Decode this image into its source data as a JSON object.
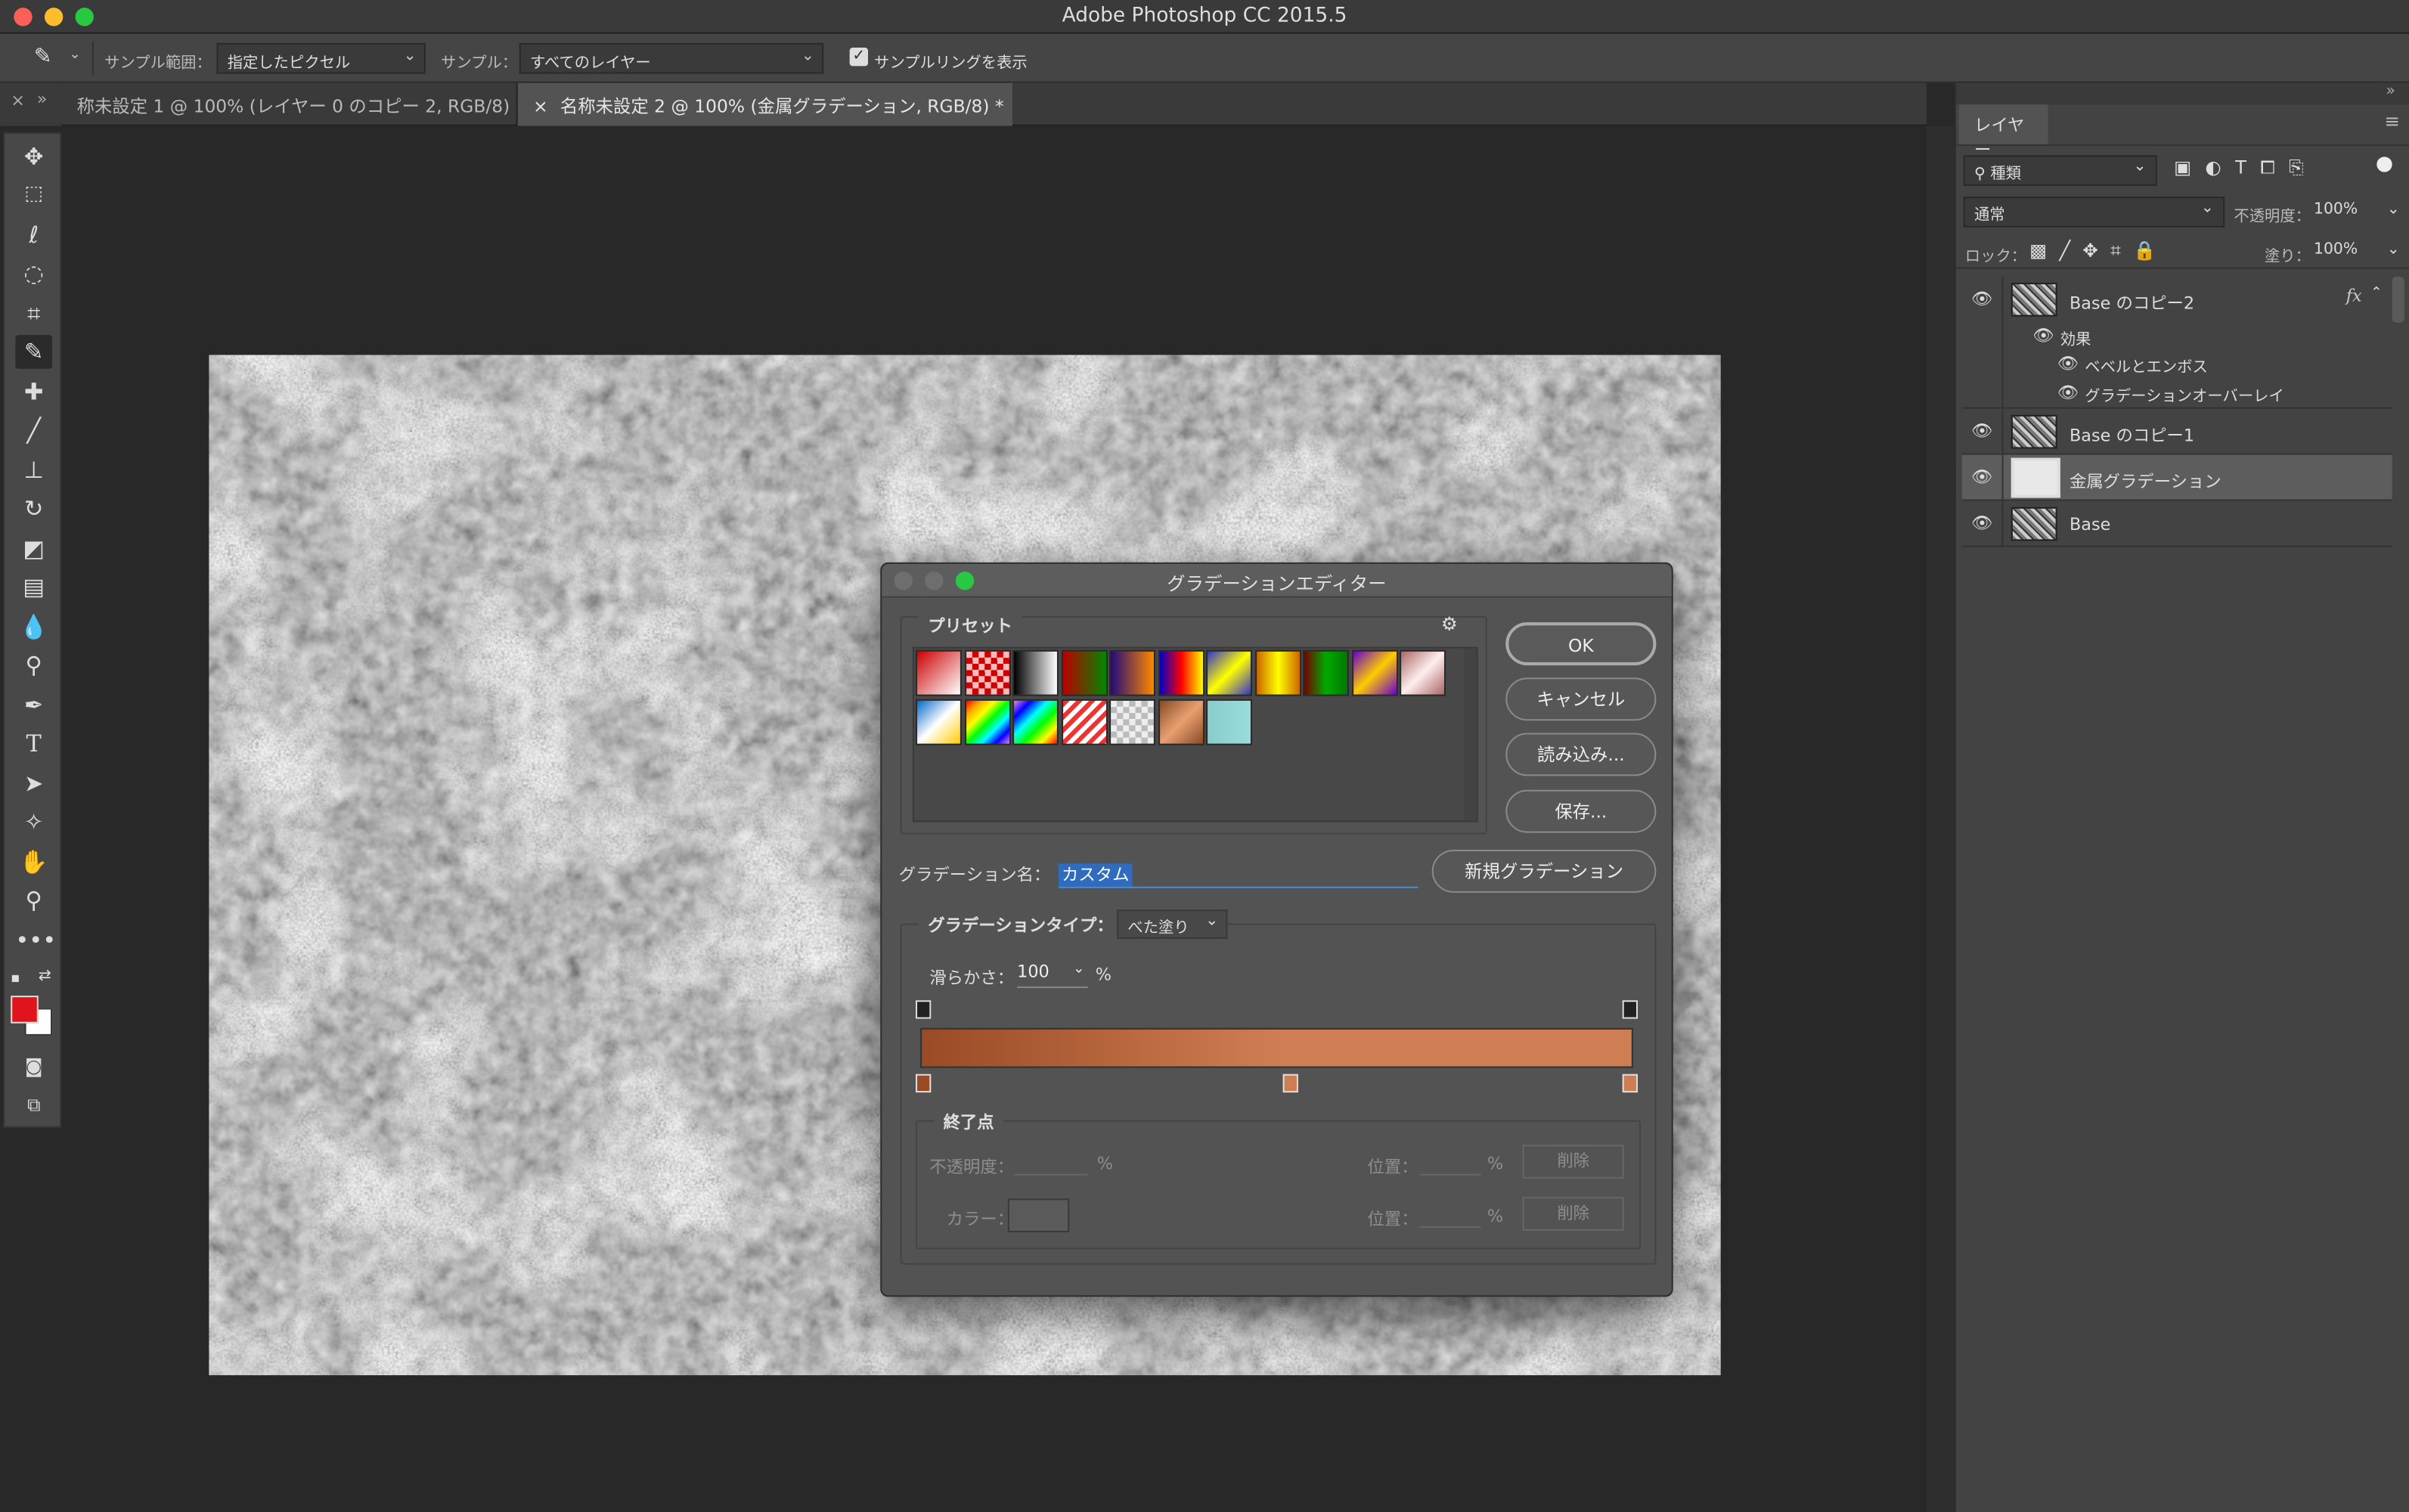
{
  "app": {
    "title": "Adobe Photoshop CC 2015.5"
  },
  "options": {
    "sample_size_label": "サンプル範囲：",
    "sample_size_value": "指定したピクセル",
    "sample_label": "サンプル：",
    "sample_value": "すべてのレイヤー",
    "show_ring_label": "サンプルリングを表示"
  },
  "tabs": [
    {
      "label": "称未設定 1 @ 100% (レイヤー 0 のコピー 2, RGB/8) *"
    },
    {
      "label": "名称未設定 2 @ 100% (金属グラデーション, RGB/8) *"
    }
  ],
  "layers_panel": {
    "title": "レイヤー",
    "filter_value": "種類",
    "blend_mode": "通常",
    "opacity_label": "不透明度：",
    "opacity_value": "100%",
    "lock_label": "ロック：",
    "fill_label": "塗り：",
    "fill_value": "100%",
    "layers": [
      {
        "name": "Base のコピー2",
        "fx": "fx"
      },
      {
        "name": "効果"
      },
      {
        "name": "ベベルとエンボス"
      },
      {
        "name": "グラデーションオーバーレイ"
      },
      {
        "name": "Base のコピー1"
      },
      {
        "name": "金属グラデーション"
      },
      {
        "name": "Base"
      }
    ]
  },
  "dialog": {
    "title": "グラデーションエディター",
    "presets_label": "プリセット",
    "ok": "OK",
    "cancel": "キャンセル",
    "load": "読み込み...",
    "save": "保存...",
    "name_label": "グラデーション名：",
    "name_value": "カスタム",
    "new_gradient": "新規グラデーション",
    "type_label": "グラデーションタイプ：",
    "type_value": "べた塗り",
    "smoothness_label": "滑らかさ：",
    "smoothness_value": "100",
    "percent": "%",
    "stops_label": "終了点",
    "opacity_label": "不透明度：",
    "color_label": "カラー：",
    "position_label": "位置：",
    "delete_label": "削除",
    "gradient_colors": [
      "#9a4b25",
      "#cf7d52"
    ]
  },
  "colors": {
    "foreground": "#e0141c",
    "background": "#ffffff"
  }
}
